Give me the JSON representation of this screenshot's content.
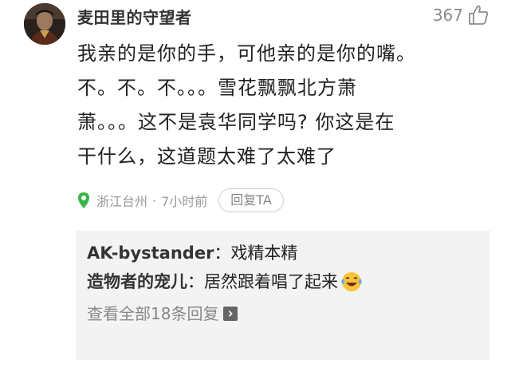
{
  "comment": {
    "username": "麦田里的守望者",
    "like_count": "367",
    "text": "我亲的是你的手，可他亲的是你的嘴。\n不。不。不。。。雪花飘飘北方萧\n萧。。。这不是袁华同学吗? 你这是在\n干什么，这道题太难了太难了",
    "location": "浙江台州",
    "separator": "·",
    "time": "7小时前",
    "reply_label": "回复TA"
  },
  "replies": {
    "items": [
      {
        "author": "AK-bystander",
        "colon": "：",
        "text": "戏精本精",
        "emoji": ""
      },
      {
        "author": "造物者的宠儿",
        "colon": "：",
        "text": "居然跟着唱了起来",
        "emoji": "laughing-tears-emoji"
      }
    ],
    "view_all": "查看全部18条回复"
  },
  "colors": {
    "location_pin": "#3bb54a",
    "reply_background": "#f3f3f3",
    "meta_text": "#999999"
  }
}
